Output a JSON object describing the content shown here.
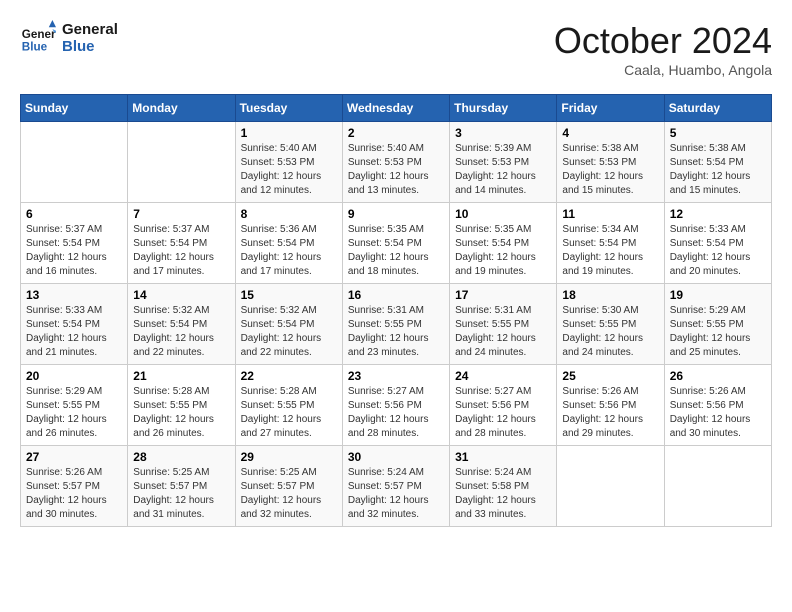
{
  "header": {
    "logo_line1": "General",
    "logo_line2": "Blue",
    "month": "October 2024",
    "location": "Caala, Huambo, Angola"
  },
  "weekdays": [
    "Sunday",
    "Monday",
    "Tuesday",
    "Wednesday",
    "Thursday",
    "Friday",
    "Saturday"
  ],
  "weeks": [
    [
      {
        "day": "",
        "info": ""
      },
      {
        "day": "",
        "info": ""
      },
      {
        "day": "1",
        "info": "Sunrise: 5:40 AM\nSunset: 5:53 PM\nDaylight: 12 hours\nand 12 minutes."
      },
      {
        "day": "2",
        "info": "Sunrise: 5:40 AM\nSunset: 5:53 PM\nDaylight: 12 hours\nand 13 minutes."
      },
      {
        "day": "3",
        "info": "Sunrise: 5:39 AM\nSunset: 5:53 PM\nDaylight: 12 hours\nand 14 minutes."
      },
      {
        "day": "4",
        "info": "Sunrise: 5:38 AM\nSunset: 5:53 PM\nDaylight: 12 hours\nand 15 minutes."
      },
      {
        "day": "5",
        "info": "Sunrise: 5:38 AM\nSunset: 5:54 PM\nDaylight: 12 hours\nand 15 minutes."
      }
    ],
    [
      {
        "day": "6",
        "info": "Sunrise: 5:37 AM\nSunset: 5:54 PM\nDaylight: 12 hours\nand 16 minutes."
      },
      {
        "day": "7",
        "info": "Sunrise: 5:37 AM\nSunset: 5:54 PM\nDaylight: 12 hours\nand 17 minutes."
      },
      {
        "day": "8",
        "info": "Sunrise: 5:36 AM\nSunset: 5:54 PM\nDaylight: 12 hours\nand 17 minutes."
      },
      {
        "day": "9",
        "info": "Sunrise: 5:35 AM\nSunset: 5:54 PM\nDaylight: 12 hours\nand 18 minutes."
      },
      {
        "day": "10",
        "info": "Sunrise: 5:35 AM\nSunset: 5:54 PM\nDaylight: 12 hours\nand 19 minutes."
      },
      {
        "day": "11",
        "info": "Sunrise: 5:34 AM\nSunset: 5:54 PM\nDaylight: 12 hours\nand 19 minutes."
      },
      {
        "day": "12",
        "info": "Sunrise: 5:33 AM\nSunset: 5:54 PM\nDaylight: 12 hours\nand 20 minutes."
      }
    ],
    [
      {
        "day": "13",
        "info": "Sunrise: 5:33 AM\nSunset: 5:54 PM\nDaylight: 12 hours\nand 21 minutes."
      },
      {
        "day": "14",
        "info": "Sunrise: 5:32 AM\nSunset: 5:54 PM\nDaylight: 12 hours\nand 22 minutes."
      },
      {
        "day": "15",
        "info": "Sunrise: 5:32 AM\nSunset: 5:54 PM\nDaylight: 12 hours\nand 22 minutes."
      },
      {
        "day": "16",
        "info": "Sunrise: 5:31 AM\nSunset: 5:55 PM\nDaylight: 12 hours\nand 23 minutes."
      },
      {
        "day": "17",
        "info": "Sunrise: 5:31 AM\nSunset: 5:55 PM\nDaylight: 12 hours\nand 24 minutes."
      },
      {
        "day": "18",
        "info": "Sunrise: 5:30 AM\nSunset: 5:55 PM\nDaylight: 12 hours\nand 24 minutes."
      },
      {
        "day": "19",
        "info": "Sunrise: 5:29 AM\nSunset: 5:55 PM\nDaylight: 12 hours\nand 25 minutes."
      }
    ],
    [
      {
        "day": "20",
        "info": "Sunrise: 5:29 AM\nSunset: 5:55 PM\nDaylight: 12 hours\nand 26 minutes."
      },
      {
        "day": "21",
        "info": "Sunrise: 5:28 AM\nSunset: 5:55 PM\nDaylight: 12 hours\nand 26 minutes."
      },
      {
        "day": "22",
        "info": "Sunrise: 5:28 AM\nSunset: 5:55 PM\nDaylight: 12 hours\nand 27 minutes."
      },
      {
        "day": "23",
        "info": "Sunrise: 5:27 AM\nSunset: 5:56 PM\nDaylight: 12 hours\nand 28 minutes."
      },
      {
        "day": "24",
        "info": "Sunrise: 5:27 AM\nSunset: 5:56 PM\nDaylight: 12 hours\nand 28 minutes."
      },
      {
        "day": "25",
        "info": "Sunrise: 5:26 AM\nSunset: 5:56 PM\nDaylight: 12 hours\nand 29 minutes."
      },
      {
        "day": "26",
        "info": "Sunrise: 5:26 AM\nSunset: 5:56 PM\nDaylight: 12 hours\nand 30 minutes."
      }
    ],
    [
      {
        "day": "27",
        "info": "Sunrise: 5:26 AM\nSunset: 5:57 PM\nDaylight: 12 hours\nand 30 minutes."
      },
      {
        "day": "28",
        "info": "Sunrise: 5:25 AM\nSunset: 5:57 PM\nDaylight: 12 hours\nand 31 minutes."
      },
      {
        "day": "29",
        "info": "Sunrise: 5:25 AM\nSunset: 5:57 PM\nDaylight: 12 hours\nand 32 minutes."
      },
      {
        "day": "30",
        "info": "Sunrise: 5:24 AM\nSunset: 5:57 PM\nDaylight: 12 hours\nand 32 minutes."
      },
      {
        "day": "31",
        "info": "Sunrise: 5:24 AM\nSunset: 5:58 PM\nDaylight: 12 hours\nand 33 minutes."
      },
      {
        "day": "",
        "info": ""
      },
      {
        "day": "",
        "info": ""
      }
    ]
  ]
}
